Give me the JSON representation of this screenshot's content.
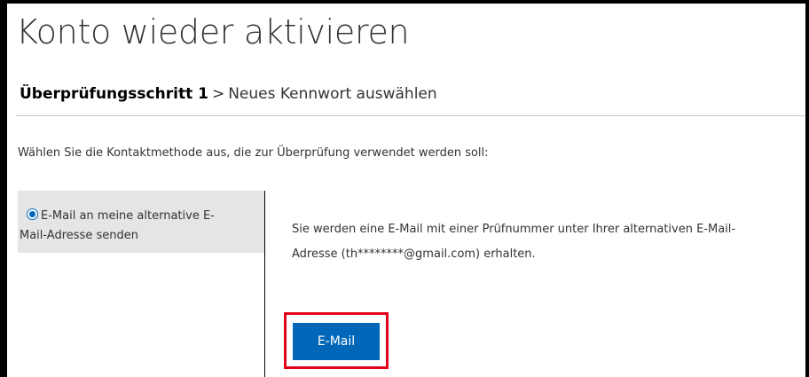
{
  "page": {
    "title": "Konto wieder aktivieren"
  },
  "breadcrumb": {
    "current": "Überprüfungsschritt 1",
    "separator": ">",
    "next": "Neues Kennwort auswählen"
  },
  "instruction": "Wählen Sie die Kontaktmethode aus, die zur Überprüfung verwendet werden soll:",
  "options": [
    {
      "label_line1": "E-Mail an meine alternative E-",
      "label_line2": "Mail-Adresse senden",
      "selected": true
    }
  ],
  "description": {
    "line1": "Sie werden eine E-Mail mit einer Prüfnummer unter Ihrer alternativen E-Mail-",
    "line2": "Adresse (th********@gmail.com) erhalten."
  },
  "email_button_label": "E-Mail",
  "colors": {
    "accent": "#0067b8",
    "highlight": "#e3001b",
    "selected_bg": "#e5e5e5"
  }
}
